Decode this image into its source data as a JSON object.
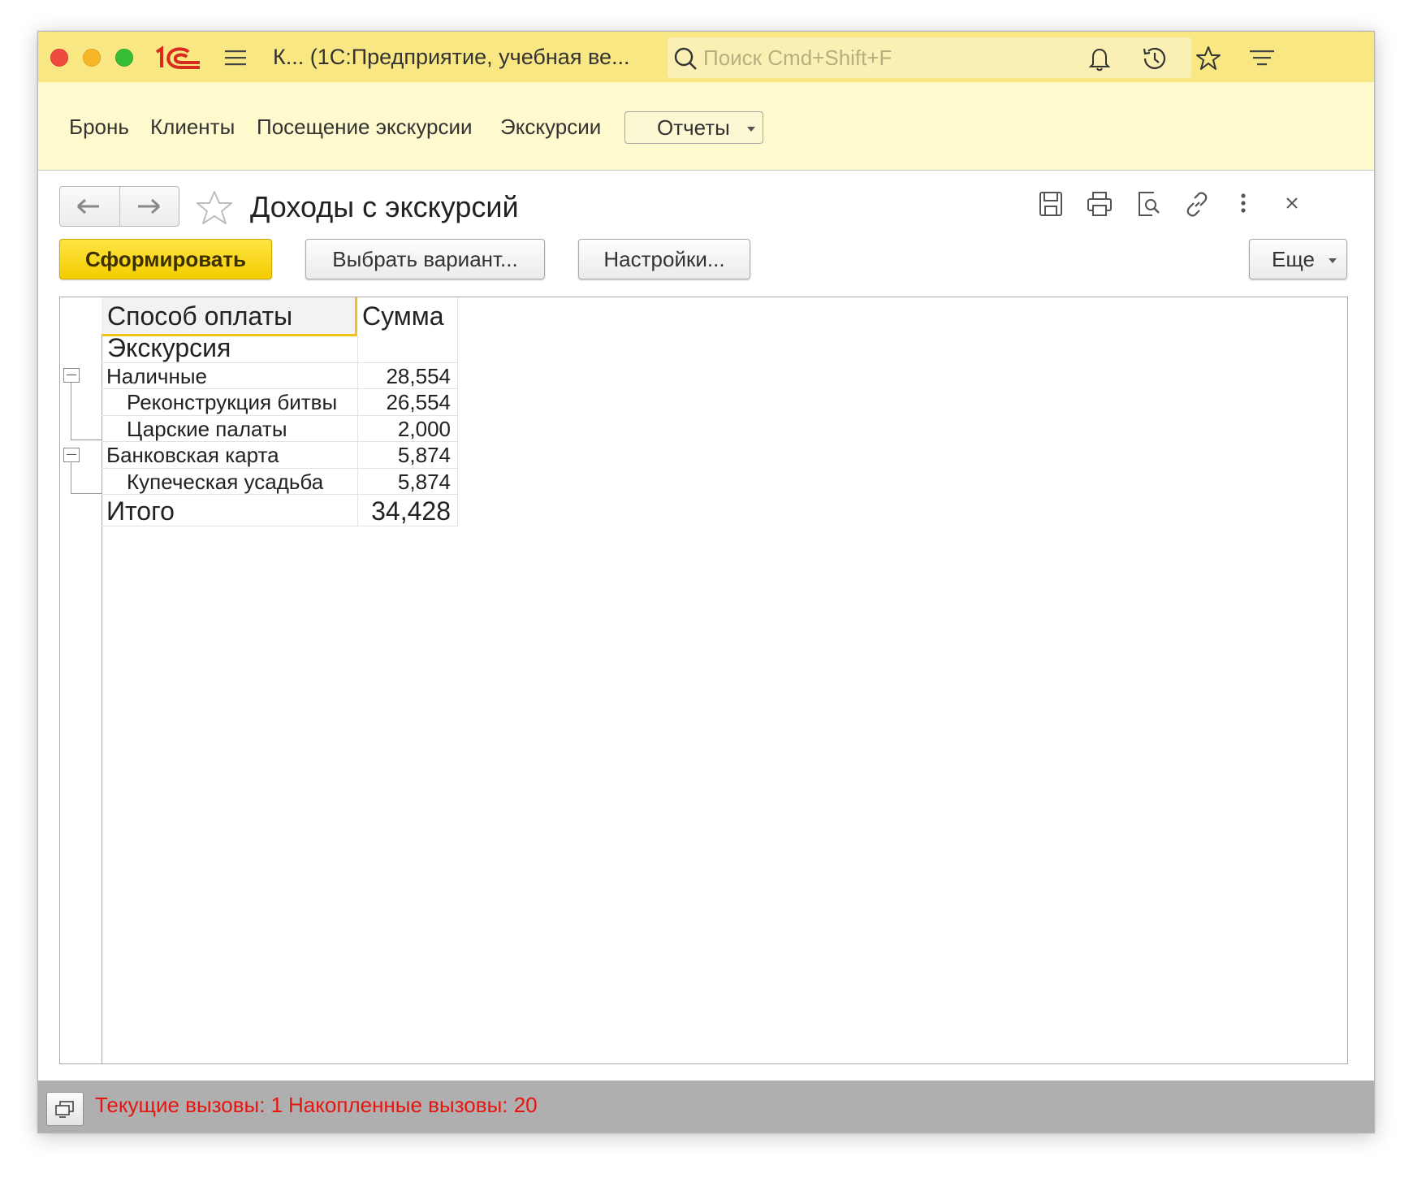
{
  "window": {
    "title": "К...  (1С:Предприятие, учебная ве...",
    "search_placeholder": "Поиск Cmd+Shift+F"
  },
  "nav": {
    "items": [
      "Бронь",
      "Клиенты",
      "Посещение экскурсии",
      "Экскурсии"
    ],
    "reports_button": "Отчеты"
  },
  "form": {
    "title": "Доходы с экскурсий",
    "buttons": {
      "generate": "Сформировать",
      "choose_variant": "Выбрать вариант...",
      "settings": "Настройки...",
      "more": "Еще"
    }
  },
  "report": {
    "headers": {
      "group1": "Способ оплаты",
      "group2": "Экскурсия",
      "value": "Сумма"
    },
    "rows": [
      {
        "label": "Наличные",
        "value": "28,554",
        "level": 0
      },
      {
        "label": "Реконструкция битвы",
        "value": "26,554",
        "level": 1
      },
      {
        "label": "Царские палаты",
        "value": "2,000",
        "level": 1
      },
      {
        "label": "Банковская карта",
        "value": "5,874",
        "level": 0
      },
      {
        "label": "Купеческая усадьба",
        "value": "5,874",
        "level": 1
      }
    ],
    "total": {
      "label": "Итого",
      "value": "34,428"
    }
  },
  "status": {
    "current_calls": "Текущие вызовы: 1",
    "accumulated_calls": "Накопленные вызовы: 20"
  },
  "colors": {
    "titlebar": "#f9e784",
    "navpanel": "#fefacd",
    "primary_button": "#f3cc00",
    "status_text": "#e8140f"
  },
  "icons": [
    "close-window",
    "minimize-window",
    "zoom-window",
    "1c-logo",
    "menu-icon",
    "search-icon",
    "bell-icon",
    "history-icon",
    "star-icon",
    "more-menu-icon",
    "back-arrow-icon",
    "forward-arrow-icon",
    "favorite-star-icon",
    "save-icon",
    "print-icon",
    "preview-icon",
    "link-icon",
    "kebab-icon",
    "close-icon",
    "monitor-icon"
  ]
}
